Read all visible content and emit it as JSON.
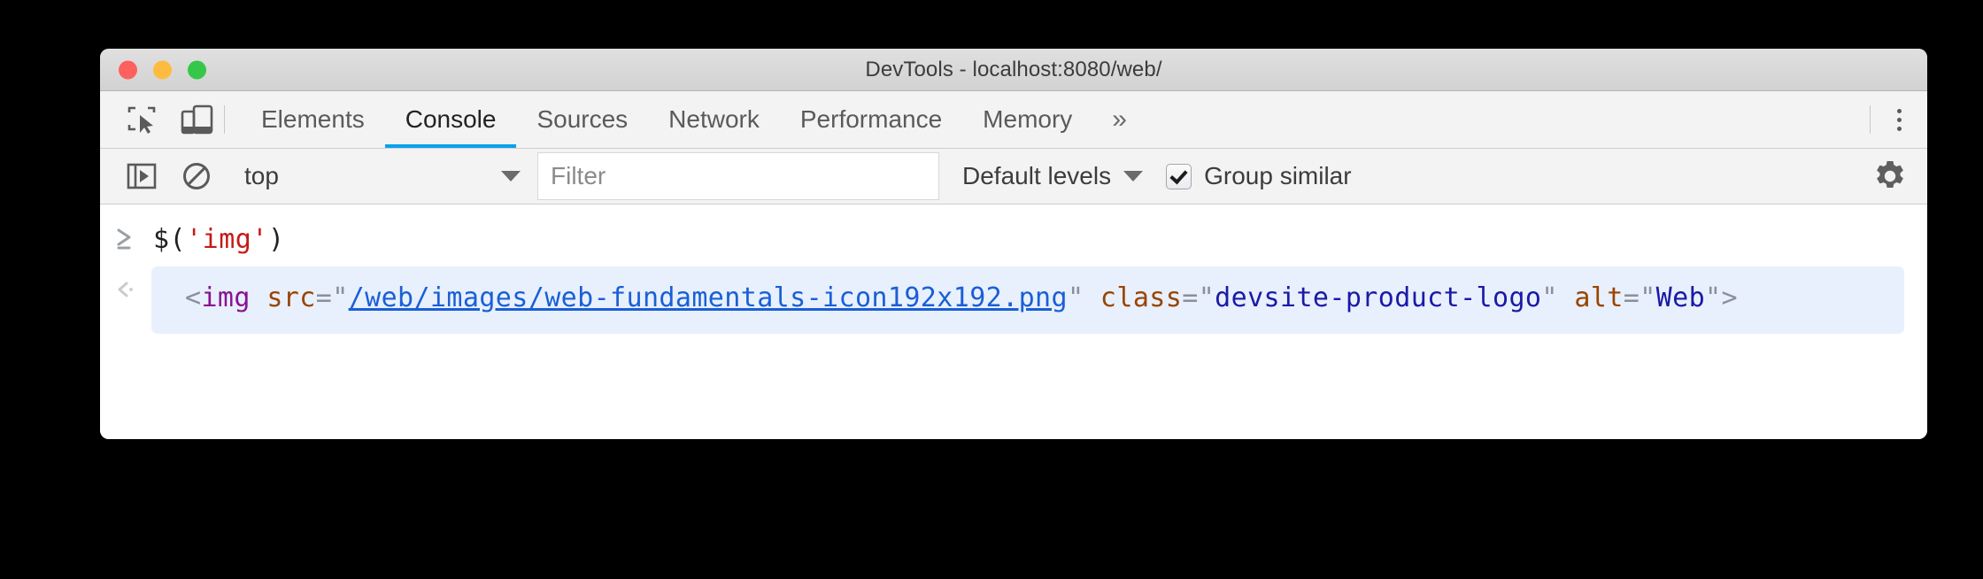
{
  "window": {
    "title": "DevTools - localhost:8080/web/",
    "traffic_lights": [
      {
        "name": "close",
        "color": "#fc615d"
      },
      {
        "name": "minimize",
        "color": "#fdbc40"
      },
      {
        "name": "maximize",
        "color": "#34c749"
      }
    ]
  },
  "tabbar": {
    "inspect_icon": "inspect-element-icon",
    "device_icon": "device-toolbar-icon",
    "tabs": [
      {
        "label": "Elements",
        "active": false
      },
      {
        "label": "Console",
        "active": true
      },
      {
        "label": "Sources",
        "active": false
      },
      {
        "label": "Network",
        "active": false
      },
      {
        "label": "Performance",
        "active": false
      },
      {
        "label": "Memory",
        "active": false
      }
    ],
    "more_tabs": "»",
    "menu_icon": "kebab-menu-icon",
    "active_underline_color": "#0aa2ea"
  },
  "console_toolbar": {
    "sidebar_toggle_icon": "console-sidebar-toggle-icon",
    "clear_icon": "clear-console-icon",
    "context": {
      "value": "top",
      "caret": "▼"
    },
    "filter": {
      "value": "",
      "placeholder": "Filter"
    },
    "levels": {
      "label": "Default levels",
      "caret": "▼"
    },
    "group_similar": {
      "label": "Group similar",
      "checked": true
    },
    "settings_icon": "gear-icon"
  },
  "console": {
    "prompt": {
      "marker": "prompt-chevron-icon",
      "code_prefix": "$(",
      "code_string": "'img'",
      "code_suffix": ")"
    },
    "result": {
      "marker": "result-chevron-icon",
      "open_bracket": "<",
      "tag_name": "img",
      "space1": " ",
      "attr1_name": "src",
      "attr1_eq": "=",
      "quote": "\"",
      "attr1_value": "/web/images/web-fundamentals-icon192x192.png",
      "space2": " ",
      "attr2_name": "class",
      "attr2_eq": "=",
      "attr2_value": "devsite-product-logo",
      "space3": " ",
      "attr3_name": "alt",
      "attr3_eq": "=",
      "attr3_value": "Web",
      "close_bracket": ">"
    }
  }
}
